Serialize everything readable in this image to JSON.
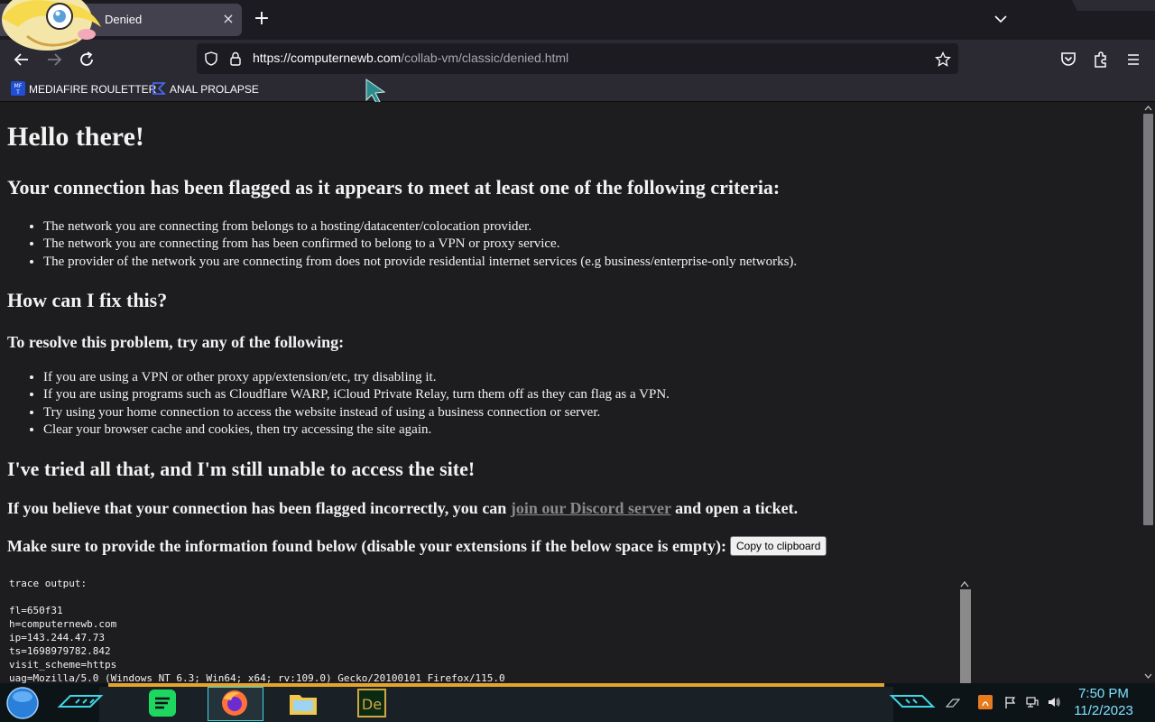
{
  "browser": {
    "tab_title": "Denied",
    "tab_close_glyph": "×",
    "new_tab_glyph": "+",
    "url_host": "https://computernewb.com",
    "url_path": "/collab-vm/classic/denied.html",
    "url_scheme_dim": "",
    "bookmarks": [
      {
        "label": "MEDIAFIRE ROULETTER",
        "icon": "mediafire-icon"
      },
      {
        "label": "ANAL PROLAPSE",
        "icon": "bookmark-sigma-icon"
      }
    ],
    "icons": {
      "back": "back-arrow-icon",
      "forward": "forward-arrow-icon",
      "reload": "reload-icon",
      "shield": "shield-icon",
      "lock": "lock-icon",
      "star": "star-icon",
      "pocket": "pocket-icon",
      "extensions": "extensions-icon",
      "menu": "hamburger-menu-icon"
    },
    "accent": "#fbfbfe"
  },
  "page": {
    "title": "Hello there!",
    "flag_heading": "Your connection has been flagged as it appears to meet at least one of the following criteria:",
    "criteria": [
      "The network you are connecting from belongs to a hosting/datacenter/colocation provider.",
      "The network you are connecting from has been confirmed to belong to a VPN or proxy service.",
      "The provider of the network you are connecting from does not provide residential internet services (e.g business/enterprise-only networks)."
    ],
    "fix_heading": "How can I fix this?",
    "resolve_heading": "To resolve this problem, try any of the following:",
    "fixes": [
      "If you are using a VPN or other proxy app/extension/etc, try disabling it.",
      "If you are using programs such as Cloudflare WARP, iCloud Private Relay, turn them off as they can flag as a VPN.",
      "Try using your home connection to access the website instead of using a business connection or server.",
      "Clear your browser cache and cookies, then try accessing the site again."
    ],
    "still_heading": "I've tried all that, and I'm still unable to access the site!",
    "discord_pre": "If you believe that your connection has been flagged incorrectly, you can ",
    "discord_link": "join our Discord server",
    "discord_post": " and open a ticket.",
    "provide_text": "Make sure to provide the information found below (disable your extensions if the below space is empty):",
    "copy_button": "Copy to clipboard",
    "trace_lines": [
      "trace output:",
      "",
      "fl=650f31",
      "h=computernewb.com",
      "ip=143.244.47.73",
      "ts=1698979782.842",
      "visit_scheme=https",
      "uag=Mozilla/5.0 (Windows NT 6.3; Win64; x64; rv:109.0) Gecko/20100101 Firefox/115.0"
    ],
    "link_color": "#8a8a8e"
  },
  "taskbar": {
    "apps": [
      "start-orb-icon",
      "spotify-icon",
      "firefox-icon",
      "file-explorer-icon",
      "dreamweaver-icon"
    ],
    "time": "7:50 PM",
    "date": "11/2/2023",
    "clock_color": "#7fe0ff",
    "accent_orange": "#e5a52b"
  }
}
